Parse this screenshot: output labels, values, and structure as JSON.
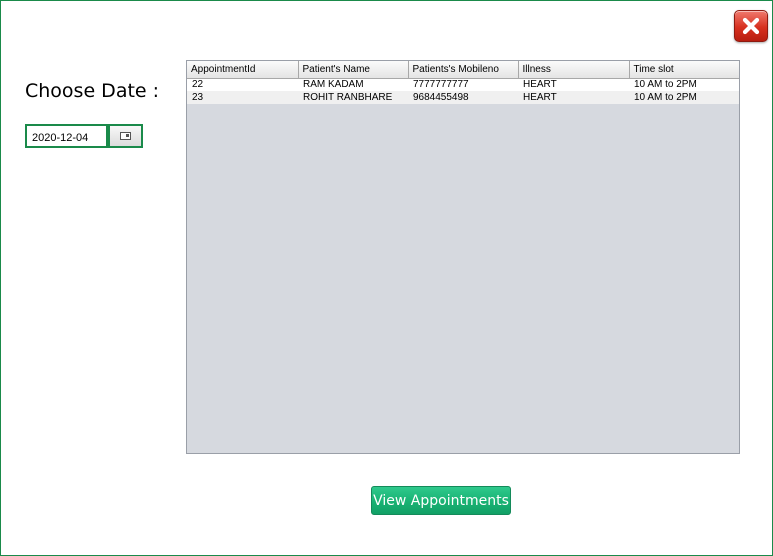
{
  "header": {
    "close_icon": "close-x-icon",
    "close_color": "#d7301f"
  },
  "filter": {
    "label": "Choose Date :",
    "date_value": "2020-12-04",
    "date_picker_icon": "calendar-icon"
  },
  "table": {
    "columns": [
      "AppointmentId",
      "Patient's Name",
      "Patients's Mobileno",
      "Illness",
      "Time slot"
    ],
    "rows": [
      [
        "22",
        "RAM KADAM",
        "7777777777",
        "HEART",
        "10 AM to 2PM"
      ],
      [
        "23",
        "ROHIT RANBHARE",
        "9684455498",
        "HEART",
        "10 AM to 2PM"
      ]
    ]
  },
  "actions": {
    "view_label": "View Appointments",
    "accent": "#18b273"
  }
}
